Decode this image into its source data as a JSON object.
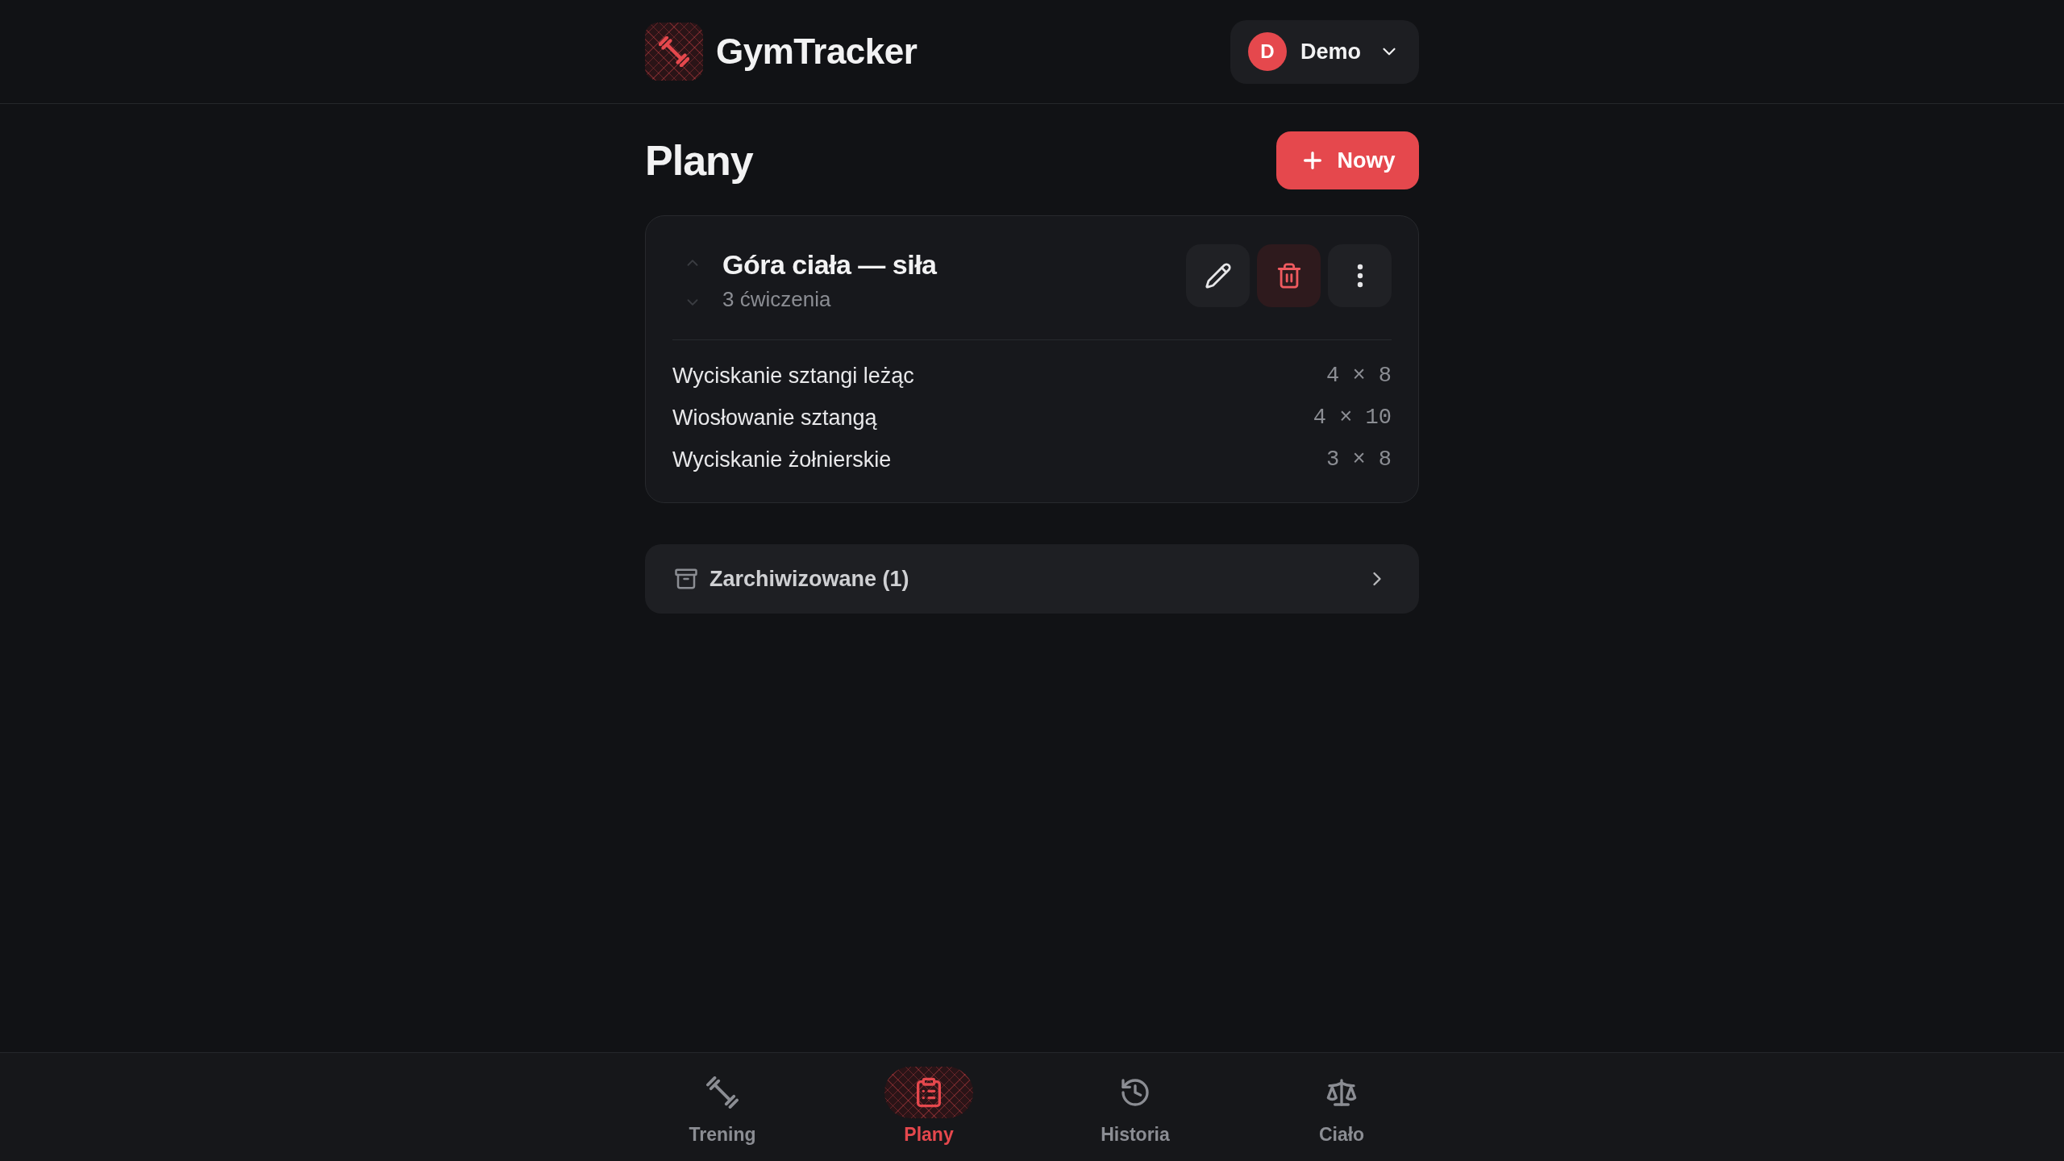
{
  "header": {
    "app_name": "GymTracker",
    "user": {
      "initial": "D",
      "name": "Demo"
    }
  },
  "page": {
    "title": "Plany",
    "new_button": "Nowy"
  },
  "plans": [
    {
      "title": "Góra ciała — siła",
      "subtitle": "3 ćwiczenia",
      "reorder": [
        {
          "kind": "up",
          "disabled": true
        },
        {
          "kind": "down",
          "disabled": true
        }
      ],
      "exercises": [
        {
          "name": "Wyciskanie sztangi leżąc",
          "scheme": "4 × 8"
        },
        {
          "name": "Wiosłowanie sztangą",
          "scheme": "4 × 10"
        },
        {
          "name": "Wyciskanie żołnierskie",
          "scheme": "3 × 8"
        }
      ]
    }
  ],
  "archived": {
    "label": "Zarchiwizowane (1)"
  },
  "nav": [
    {
      "label": "Trening",
      "selected": false
    },
    {
      "label": "Plany",
      "selected": true
    },
    {
      "label": "Historia",
      "selected": false
    },
    {
      "label": "Ciało",
      "selected": false
    }
  ]
}
